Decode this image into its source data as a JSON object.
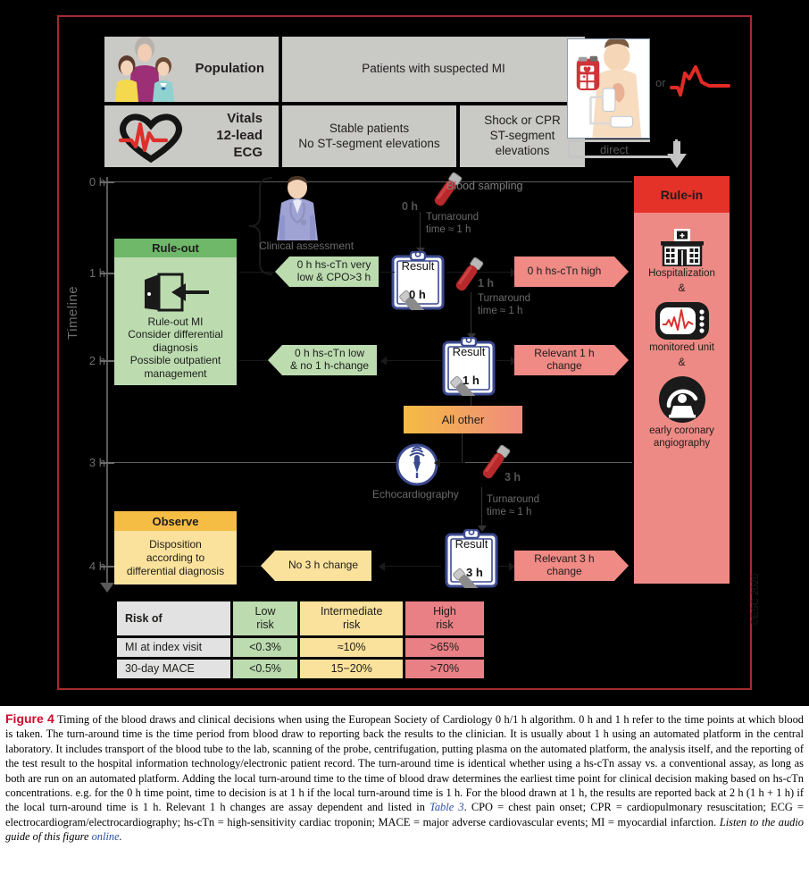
{
  "figure": {
    "copyright": "©ESC 2020",
    "colors": {
      "border": "#a32b2e",
      "grey_panel": "#c9c9c6",
      "rule_out_header": "#6fb86a",
      "rule_out_body": "#bcdcb0",
      "rule_in_header": "#e53228",
      "rule_in_body": "#ee8a85",
      "observe_header": "#f5bd44",
      "observe_body": "#fbe29c",
      "red_arrow": "#ef8a85",
      "caption_figno": "#cf0a2c"
    }
  },
  "top_panel": {
    "population_label": "Population",
    "population_value": "Patients with suspected MI",
    "vitals_label": "Vitals\n12-lead\nECG",
    "vitals_label_lines": [
      "Vitals",
      "12-lead",
      "ECG"
    ],
    "stable_lines": [
      "Stable patients",
      "No ST-segment elevations"
    ],
    "shock_lines": [
      "Shock or CPR",
      "ST-segment",
      "elevations"
    ],
    "or_label": "or",
    "direct_label": "direct"
  },
  "timeline": {
    "axis_label": "Timeline",
    "ticks": [
      "0 h",
      "1 h",
      "2 h",
      "3 h",
      "4 h"
    ]
  },
  "rule_out": {
    "header": "Rule-out",
    "body_lines": [
      "Rule-out MI",
      "Consider differential",
      "diagnosis",
      "Possible outpatient",
      "management"
    ]
  },
  "observe": {
    "header": "Observe",
    "body_lines": [
      "Disposition",
      "according to",
      "differential diagnosis"
    ]
  },
  "rule_in": {
    "header": "Rule-in",
    "items": [
      {
        "icon": "hospital-icon",
        "label": "Hospitalization"
      },
      {
        "icon": "monitor-ecg-icon",
        "label": "monitored unit"
      },
      {
        "icon": "angiography-icon",
        "label": "early coronary angiography"
      }
    ],
    "amp1": "&",
    "amp2": "&",
    "label1": "Hospitalization",
    "label2": "monitored unit",
    "label3_line1": "early coronary",
    "label3_line2": "angiography"
  },
  "flow": {
    "blood_sampling_label": "Blood sampling",
    "clinical_assessment_label": "Clinical assessment",
    "echocardiography_label": "Echocardiography",
    "tube_0h": "0 h",
    "tube_1h": "1 h",
    "tube_3h": "3 h",
    "turnaround_line1": "Turnaround",
    "turnaround_line2": "time ≈ 1 h",
    "result_word": "Result",
    "result_0h": "0 h",
    "result_1h": "1 h",
    "result_3h": "3 h",
    "all_other": "All other",
    "green_1_line1": "0 h hs-cTn very",
    "green_1_line2": "low & CPO>3 h",
    "green_2_line1": "0 h hs-cTn low",
    "green_2_line2": "& no 1 h-change",
    "red_1": "0 h hs-cTn high",
    "red_2": "Relevant 1 h change",
    "red_3": "Relevant 3 h change",
    "yellow_1": "No 3 h change"
  },
  "risk_table": {
    "headers": [
      "Risk of",
      "Low\nrisk",
      "Intermediate\nrisk",
      "High\nrisk"
    ],
    "header_label": "Risk of",
    "header_low_l1": "Low",
    "header_low_l2": "risk",
    "header_mid_l1": "Intermediate",
    "header_mid_l2": "risk",
    "header_high_l1": "High",
    "header_high_l2": "risk",
    "rows": [
      {
        "label": "MI at index visit",
        "low": "<0.3%",
        "intermediate": "≈10%",
        "high": ">65%"
      },
      {
        "label": "30-day MACE",
        "low": "<0.5%",
        "intermediate": "15–20%",
        "high": ">70%"
      }
    ],
    "row1_label": "MI at index visit",
    "row1_low": "<0.3%",
    "row1_mid": "≈10%",
    "row1_high": ">65%",
    "row2_label": "30-day MACE",
    "row2_low": "<0.5%",
    "row2_mid": "15−20%",
    "row2_high": ">70%"
  },
  "caption": {
    "figure_number": "Figure 4",
    "part1": " Timing of the blood draws and clinical decisions when using the European Society of Cardiology 0 h/1 h algorithm. 0 h and 1 h refer to the time points at which blood is taken. The turn-around time is the time period from blood draw to reporting back the results to the clinician. It is usually about 1 h using an automated platform in the central laboratory. It includes transport of the blood tube to the lab, scanning of the probe, centrifugation, putting plasma on the automated platform, the analysis itself, and the reporting of the test result to the hospital information technology/electronic patient record. The turn-around time is identical whether using a hs-cTn assay vs. a conventional assay, as long as both are run on an automated platform. Adding the local turn-around time to the time of blood draw determines the earliest time point for clinical decision making based on hs-cTn concentrations. e.g. for the 0 h time point, time to decision is at 1 h if the local turn-around time is 1 h. For the blood drawn at 1 h, the results are reported back at 2 h (1 h + 1 h) if the local turn-around time is 1 h. Relevant 1 h changes are assay dependent and listed in ",
    "table_link": "Table 3",
    "part2": ". CPO = chest pain onset; CPR = cardiopulmonary resuscitation; ECG = electrocardiogram/electrocardiography; hs-cTn = high-sensitivity cardiac troponin; MACE = major adverse cardiovascular events; MI = myocardial infarction. ",
    "audio_text": "Listen to the audio guide of this figure ",
    "audio_link": "online",
    "period": "."
  }
}
